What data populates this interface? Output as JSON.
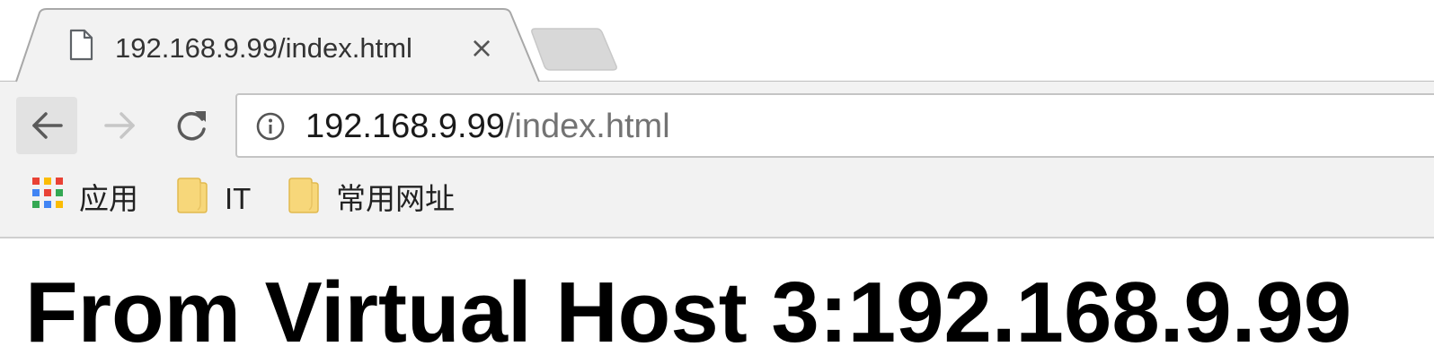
{
  "tab": {
    "title": "192.168.9.99/index.html",
    "close_glyph": "×",
    "favicon": "page-icon"
  },
  "toolbar": {
    "back_icon": "back-arrow-icon",
    "forward_icon": "forward-arrow-icon",
    "reload_icon": "reload-icon",
    "address": {
      "host": "192.168.9.99",
      "path": "/index.html",
      "security_icon": "info-icon"
    }
  },
  "bookmarks": [
    {
      "label": "应用",
      "icon": "apps-grid-icon"
    },
    {
      "label": "IT",
      "icon": "folder-icon"
    },
    {
      "label": "常用网址",
      "icon": "folder-icon"
    }
  ],
  "page": {
    "heading": "From Virtual Host 3:192.168.9.99"
  },
  "colors": {
    "toolbar_bg": "#f2f2f2",
    "folder_yellow": "#f7d77a",
    "url_path_gray": "#737373"
  }
}
